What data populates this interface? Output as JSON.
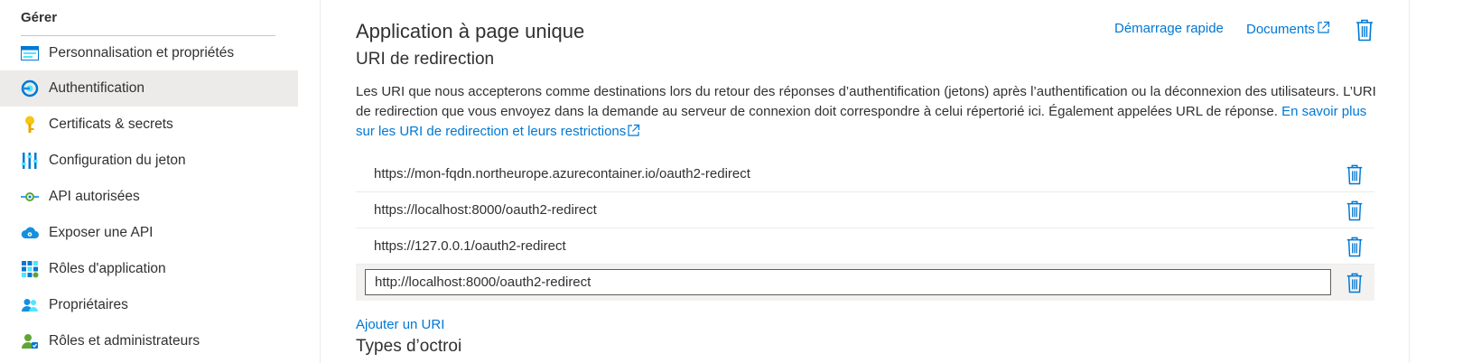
{
  "sidebar": {
    "header": "Gérer",
    "items": [
      {
        "label": "Personnalisation et propriétés",
        "icon": "branding-icon",
        "active": false
      },
      {
        "label": "Authentification",
        "icon": "authentication-icon",
        "active": true
      },
      {
        "label": "Certificats & secrets",
        "icon": "key-icon",
        "active": false
      },
      {
        "label": "Configuration du jeton",
        "icon": "token-config-icon",
        "active": false
      },
      {
        "label": "API autorisées",
        "icon": "api-permissions-icon",
        "active": false
      },
      {
        "label": "Exposer une API",
        "icon": "cloud-api-icon",
        "active": false
      },
      {
        "label": "Rôles d'application",
        "icon": "app-roles-icon",
        "active": false
      },
      {
        "label": "Propriétaires",
        "icon": "owners-icon",
        "active": false
      },
      {
        "label": "Rôles et administrateurs",
        "icon": "roles-admins-icon",
        "active": false
      }
    ]
  },
  "main": {
    "title": "Application à page unique",
    "subtitle": "URI de redirection",
    "quickstart": "Démarrage rapide",
    "docs": "Documents",
    "description": "Les URI que nous accepterons comme destinations lors du retour des réponses d’authentification (jetons) après l’authentification ou la déconnexion des utilisateurs. L’URI de redirection que vous envoyez dans la demande au serveur de connexion doit correspondre à celui répertorié ici. Également appelées URL de réponse.",
    "learn_more": "En savoir plus sur les URI de redirection et leurs restrictions",
    "redirect_uris": [
      "https://mon-fqdn.northeurope.azurecontainer.io/oauth2-redirect",
      "https://localhost:8000/oauth2-redirect",
      "https://127.0.0.1/oauth2-redirect"
    ],
    "editing_uri": "http://localhost:8000/oauth2-redirect",
    "add_uri": "Ajouter un URI",
    "next_section": "Types d’octroi"
  },
  "colors": {
    "accent": "#0078d4",
    "text": "#323130",
    "active_bg": "#edebe9"
  }
}
